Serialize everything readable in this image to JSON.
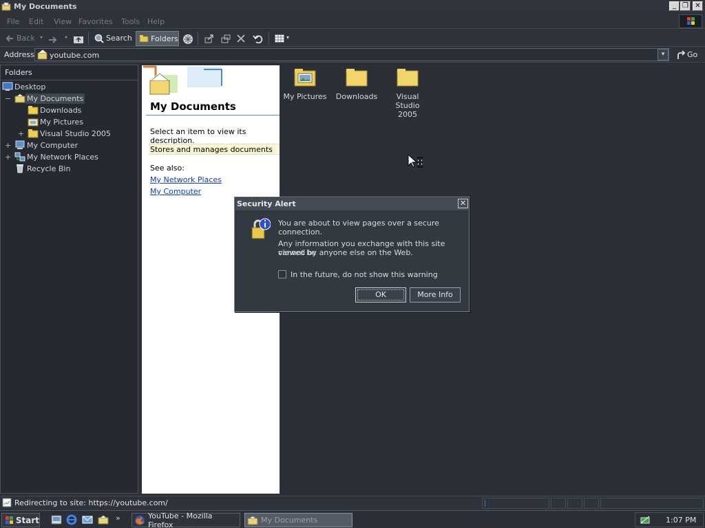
{
  "window": {
    "title": "My Documents"
  },
  "menu": [
    "File",
    "Edit",
    "View",
    "Favorites",
    "Tools",
    "Help"
  ],
  "toolbar": {
    "back": "Back",
    "search": "Search",
    "folders": "Folders"
  },
  "address": {
    "label": "Address",
    "value": "youtube.com",
    "go": "Go"
  },
  "folders_pane": {
    "header": "Folders",
    "tree": [
      {
        "label": "Desktop"
      },
      {
        "label": "My Documents"
      },
      {
        "label": "Downloads"
      },
      {
        "label": "My Pictures"
      },
      {
        "label": "Visual Studio 2005"
      },
      {
        "label": "My Computer"
      },
      {
        "label": "My Network Places"
      },
      {
        "label": "Recycle Bin"
      }
    ]
  },
  "task_pane": {
    "title": "My Documents",
    "prompt": "Select an item to view its description.",
    "description": "Stores and manages documents",
    "see_also": "See also:",
    "links": [
      "My Network Places",
      "My Computer"
    ]
  },
  "content_items": [
    {
      "label_line1": "My Pictures",
      "label_line2": ""
    },
    {
      "label_line1": "Downloads",
      "label_line2": ""
    },
    {
      "label_line1": "Visual Studio",
      "label_line2": "2005"
    }
  ],
  "dialog": {
    "title": "Security Alert",
    "line1": "You are about to view pages over a secure connection.",
    "line2a": "Any information you exchange with this site cannot be",
    "line2b": "viewed by anyone else on the Web.",
    "checkbox": "In the future, do not show this warning",
    "ok": "OK",
    "more_info": "More Info"
  },
  "status": {
    "text": "Redirecting to site: https://youtube.com/"
  },
  "taskbar": {
    "start": "Start",
    "tasks": [
      "YouTube - Mozilla Firefox",
      "My Documents"
    ],
    "clock": "1:07 PM"
  }
}
